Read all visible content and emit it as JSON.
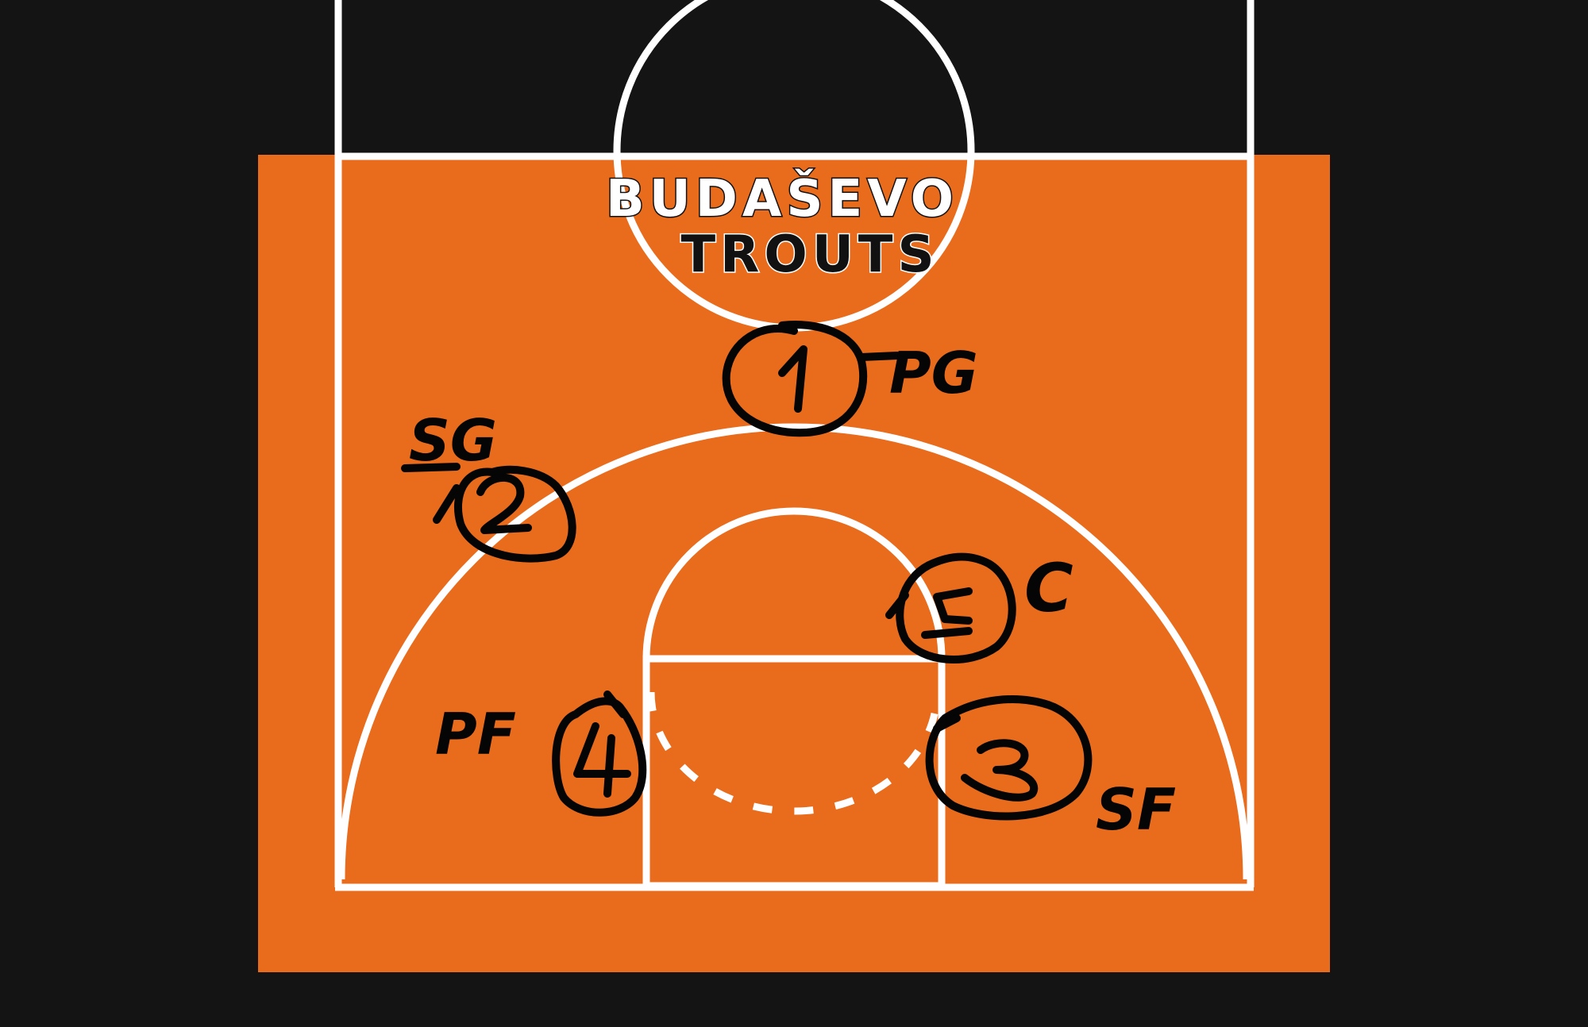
{
  "team": {
    "line1": "BUDAŠEVO",
    "line2": "TROUTS"
  },
  "positions": [
    {
      "number": "1",
      "label": "PG",
      "role": "point-guard"
    },
    {
      "number": "2",
      "label": "SG",
      "role": "shooting-guard"
    },
    {
      "number": "3",
      "label": "SF",
      "role": "small-forward"
    },
    {
      "number": "4",
      "label": "PF",
      "role": "power-forward"
    },
    {
      "number": "5",
      "label": "C",
      "role": "center"
    }
  ],
  "colors": {
    "background": "#141414",
    "court": "#e96b1c",
    "lines": "#ffffff",
    "ink": "#050505"
  }
}
